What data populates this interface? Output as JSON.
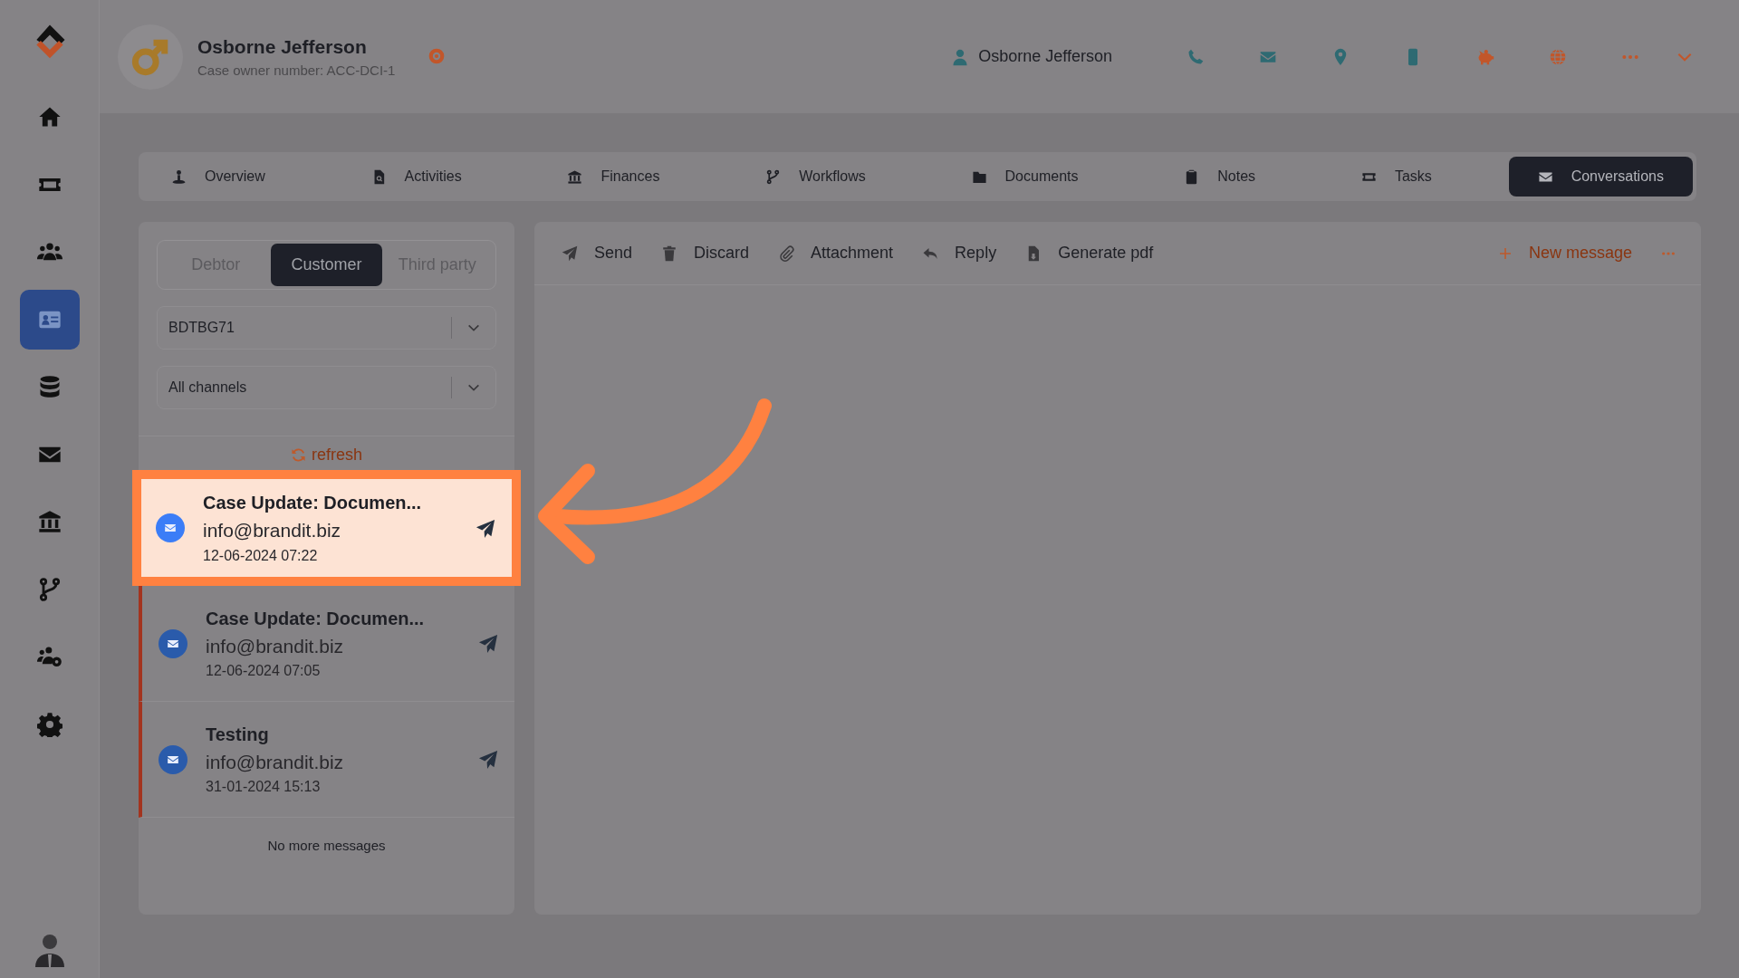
{
  "sidebar": {
    "items": [
      {
        "selected": false
      },
      {
        "selected": false
      },
      {
        "selected": false
      },
      {
        "selected": true
      },
      {
        "selected": false
      },
      {
        "selected": false
      },
      {
        "selected": false
      },
      {
        "selected": false
      },
      {
        "selected": false
      },
      {
        "selected": false
      }
    ]
  },
  "header": {
    "name": "Osborne Jefferson",
    "case_owner": "Case owner number: ACC-DCI-1",
    "contact_name": "Osborne Jefferson"
  },
  "tabs": [
    {
      "label": "Overview",
      "selected": false
    },
    {
      "label": "Activities",
      "selected": false
    },
    {
      "label": "Finances",
      "selected": false
    },
    {
      "label": "Workflows",
      "selected": false
    },
    {
      "label": "Documents",
      "selected": false
    },
    {
      "label": "Notes",
      "selected": false
    },
    {
      "label": "Tasks",
      "selected": false
    },
    {
      "label": "Conversations",
      "selected": true
    }
  ],
  "party_tabs": [
    {
      "label": "Debtor",
      "selected": false
    },
    {
      "label": "Customer",
      "selected": true
    },
    {
      "label": "Third party",
      "selected": false
    }
  ],
  "selects": [
    {
      "value": "BDTBG71"
    },
    {
      "value": "All channels"
    }
  ],
  "refresh": "refresh",
  "messages": [
    {
      "subject": "Case Update: Documen...",
      "from": "info@brandit.biz",
      "date": "12-06-2024 07:22",
      "highlighted": true
    },
    {
      "subject": "Case Update: Documen...",
      "from": "info@brandit.biz",
      "date": "12-06-2024 07:05",
      "highlighted": false
    },
    {
      "subject": "Testing",
      "from": "info@brandit.biz",
      "date": "31-01-2024 15:13",
      "highlighted": false
    }
  ],
  "list_footer": "No more messages",
  "toolbar": {
    "actions": [
      {
        "label": "Send"
      },
      {
        "label": "Discard"
      },
      {
        "label": "Attachment"
      },
      {
        "label": "Reply"
      },
      {
        "label": "Generate pdf"
      }
    ],
    "new_message": "New message"
  }
}
